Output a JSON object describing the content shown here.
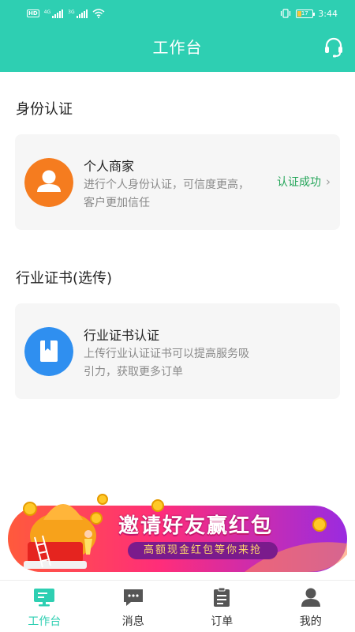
{
  "status_bar": {
    "hd": "HD",
    "sig1": "4G",
    "sig2": "3G",
    "battery": "17",
    "time": "3:44"
  },
  "header": {
    "title": "工作台",
    "support_icon": "headset-icon"
  },
  "identity": {
    "section_title": "身份认证",
    "card": {
      "name": "个人商家",
      "description": "进行个人身份认证，可信度更高，客户更加信任",
      "status": "认证成功",
      "icon": "person-avatar-icon"
    }
  },
  "certificate": {
    "section_title": "行业证书(选传)",
    "card": {
      "name": "行业证书认证",
      "description": "上传行业认证证书可以提高服务吸引力，获取更多订单",
      "icon": "bookmark-book-icon"
    }
  },
  "banner": {
    "title": "邀请好友赢红包",
    "subtitle": "高额现金红包等你来抢"
  },
  "tabs": [
    {
      "label": "工作台",
      "icon": "monitor-icon",
      "active": true
    },
    {
      "label": "消息",
      "icon": "chat-icon",
      "active": false
    },
    {
      "label": "订单",
      "icon": "clipboard-icon",
      "active": false
    },
    {
      "label": "我的",
      "icon": "user-icon",
      "active": false
    }
  ],
  "colors": {
    "accent": "#2ecfb2",
    "success": "#26a65b",
    "avatar_orange": "#f57c1f",
    "cert_blue": "#2f8ff0"
  }
}
